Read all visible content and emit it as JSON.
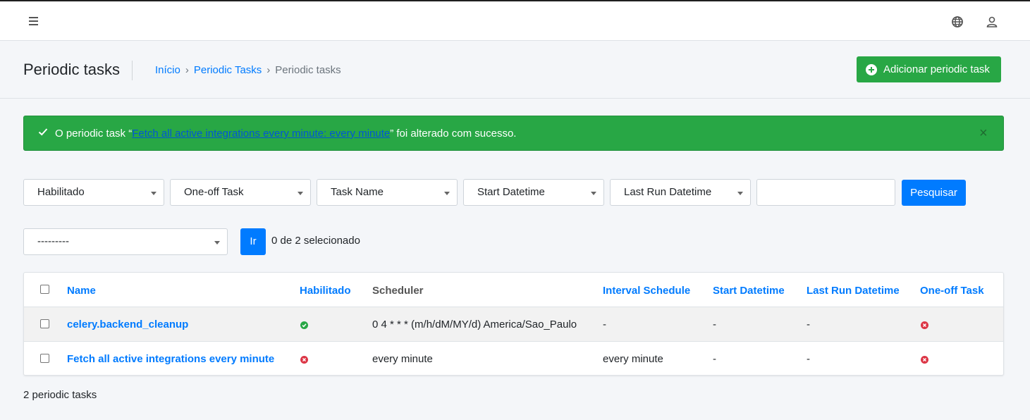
{
  "navbar": {
    "menu_icon": "hamburger-icon",
    "language_icon": "globe-icon",
    "user_icon": "user-icon"
  },
  "header": {
    "title": "Periodic tasks",
    "breadcrumb": [
      {
        "label": "Início",
        "link": true
      },
      {
        "label": "Periodic Tasks",
        "link": true
      },
      {
        "label": "Periodic tasks",
        "link": false
      }
    ],
    "add_button_label": "Adicionar periodic task"
  },
  "alert": {
    "prefix": "O periodic task “",
    "link_text": "Fetch all active integrations every minute: every minute",
    "suffix": "” foi alterado com sucesso.",
    "close": "×"
  },
  "filters": [
    {
      "label": "Habilitado"
    },
    {
      "label": "One-off Task"
    },
    {
      "label": "Task Name"
    },
    {
      "label": "Start Datetime"
    },
    {
      "label": "Last Run Datetime"
    }
  ],
  "search": {
    "value": "",
    "button_label": "Pesquisar"
  },
  "actions": {
    "selected_option": "---------",
    "go_label": "Ir",
    "selection_count": "0 de 2 selecionado"
  },
  "table": {
    "columns": [
      "Name",
      "Habilitado",
      "Scheduler",
      "Interval Schedule",
      "Start Datetime",
      "Last Run Datetime",
      "One-off Task"
    ],
    "rows": [
      {
        "name": "celery.backend_cleanup",
        "enabled": true,
        "scheduler": "0 4 * * * (m/h/dM/MY/d) America/Sao_Paulo",
        "interval": "-",
        "start": "-",
        "last_run": "-",
        "one_off": false
      },
      {
        "name": "Fetch all active integrations every minute",
        "enabled": false,
        "scheduler": "every minute",
        "interval": "every minute",
        "start": "-",
        "last_run": "-",
        "one_off": false
      }
    ]
  },
  "footer": {
    "count_text": "2 periodic tasks"
  },
  "colors": {
    "primary": "#007bff",
    "success": "#28a745",
    "danger": "#dc3545"
  }
}
